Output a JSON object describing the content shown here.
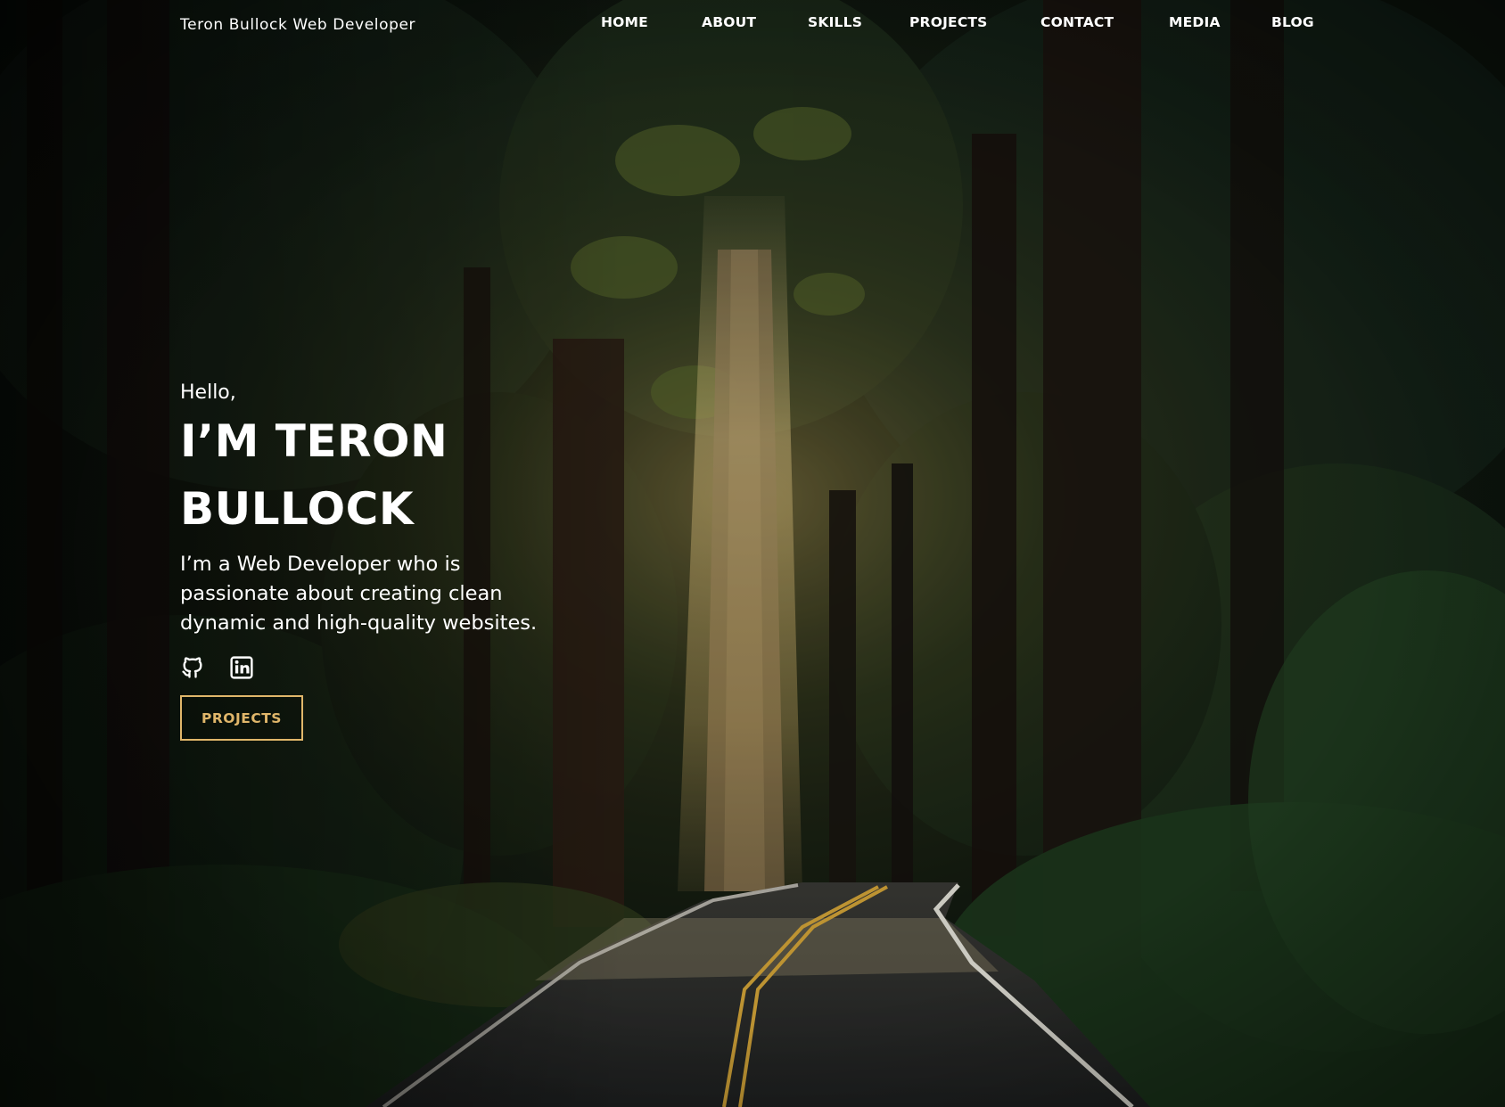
{
  "header": {
    "brand": "Teron Bullock Web Developer",
    "nav": [
      {
        "label": "HOME"
      },
      {
        "label": "ABOUT"
      },
      {
        "label": "SKILLS"
      },
      {
        "label": "PROJECTS"
      },
      {
        "label": "CONTACT"
      },
      {
        "label": "MEDIA"
      },
      {
        "label": "BLOG"
      }
    ]
  },
  "hero": {
    "greeting": "Hello,",
    "name": "I’M TERON BULLOCK",
    "tagline": "I’m a Web Developer who is passionate about creating clean dynamic and high-quality websites.",
    "socials": [
      {
        "icon": "github-icon"
      },
      {
        "icon": "linkedin-icon"
      }
    ],
    "cta_label": "PROJECTS"
  },
  "colors": {
    "accent": "#e0b66a",
    "text": "#ffffff",
    "forest_dark": "#0b120c",
    "road": "#2b2c2c",
    "road_line": "#d8a83a"
  }
}
